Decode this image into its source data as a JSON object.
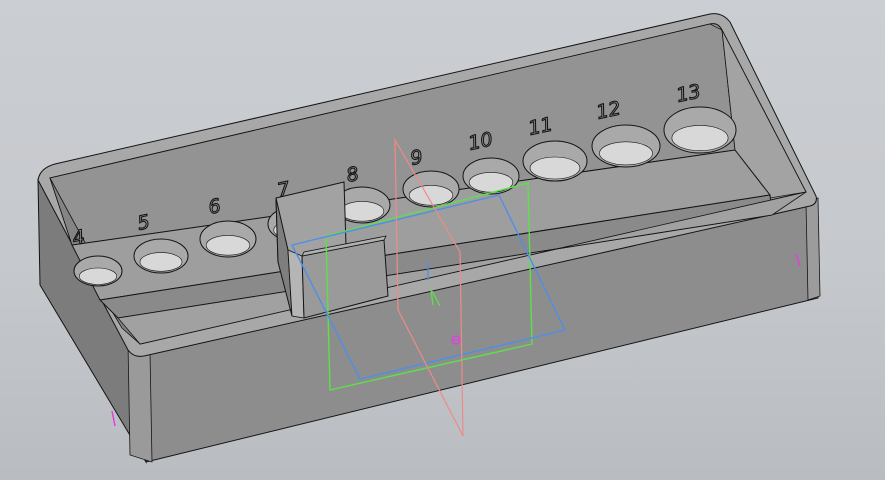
{
  "viewport": {
    "background_color": "#c5c8cc"
  },
  "model": {
    "body_color": "#8f8f8f",
    "edge_color": "#141414",
    "hole_color": "#d8d8d8",
    "socket_labels": [
      "4",
      "5",
      "6",
      "7",
      "8",
      "9",
      "10",
      "11",
      "12",
      "13"
    ]
  },
  "planes": {
    "green_color": "#5ee04a",
    "blue_color": "#4f8ee8",
    "red_color": "#f08a8a",
    "origin_marker_color": "#e040e0"
  }
}
